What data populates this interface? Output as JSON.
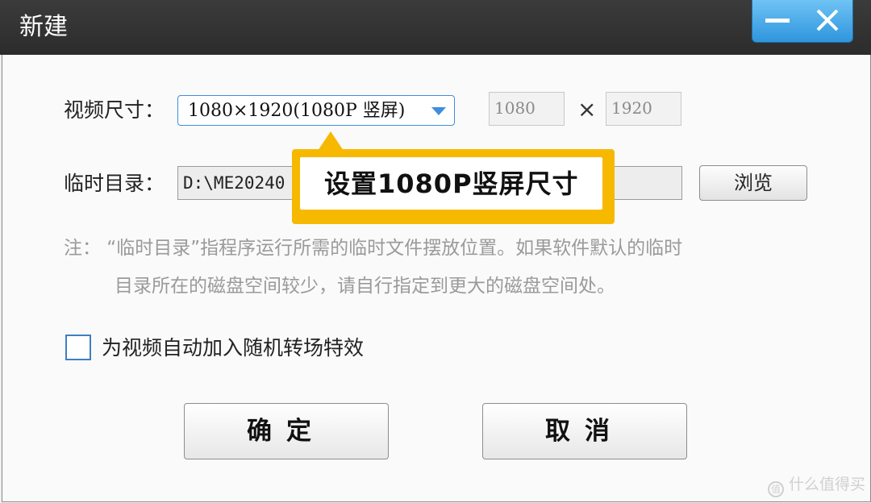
{
  "window": {
    "title": "新建"
  },
  "video_size": {
    "label": "视频尺寸：",
    "selected": "1080×1920(1080P 竖屏)",
    "width": "1080",
    "height": "1920",
    "times_symbol": "×"
  },
  "temp_dir": {
    "label": "临时目录：",
    "path": "D:\\ME20240",
    "browse_label": "浏览"
  },
  "callout": {
    "text": "设置1080P竖屏尺寸"
  },
  "note": {
    "line1": "注：  “临时目录”指程序运行所需的临时文件摆放位置。如果软件默认的临时",
    "line2": "目录所在的磁盘空间较少，请自行指定到更大的磁盘空间处。"
  },
  "random_transition": {
    "label": "为视频自动加入随机转场特效",
    "checked": false
  },
  "buttons": {
    "ok": "确定",
    "cancel": "取消"
  },
  "watermark": {
    "text": "什么值得买",
    "icon_glyph": "值"
  },
  "colors": {
    "accent": "#3d8ede",
    "callout": "#f6b900",
    "titlebar": "#2f2f2f"
  }
}
